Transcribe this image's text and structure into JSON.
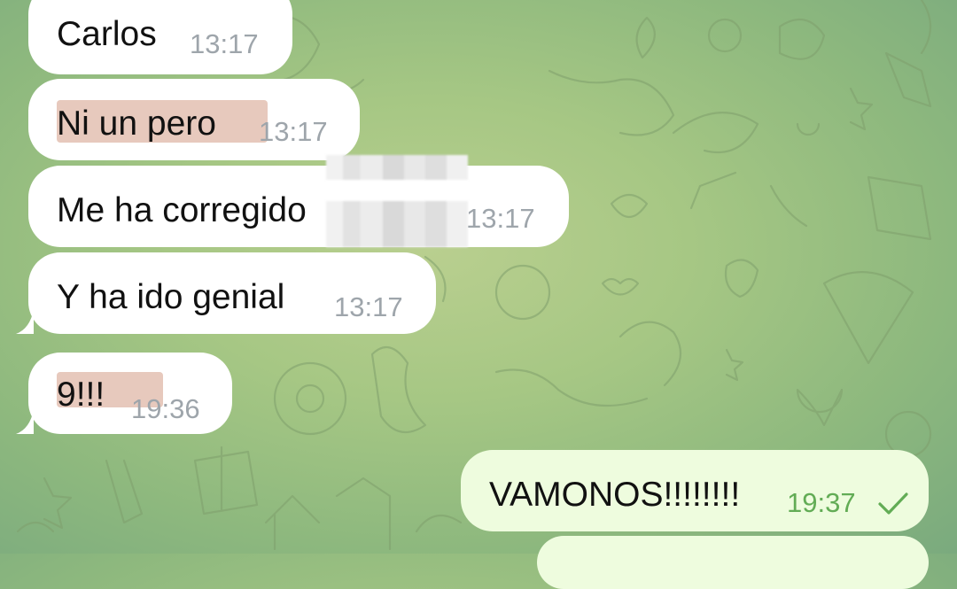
{
  "messages": [
    {
      "text": "Carlos",
      "time": "13:17"
    },
    {
      "text": "Ni un pero",
      "time": "13:17"
    },
    {
      "text": "Me ha corregido",
      "time": "13:17"
    },
    {
      "text": "Y ha ido genial",
      "time": "13:17"
    },
    {
      "text": "9!!!",
      "time": "19:36"
    },
    {
      "text": "VAMONOS!!!!!!!!",
      "time": "19:37"
    }
  ],
  "icons": {
    "read_status": "check-icon"
  },
  "colors": {
    "incoming_bubble": "#ffffff",
    "outgoing_bubble": "#eefcde",
    "highlight": "#e7c9bd",
    "time_incoming": "#9ea5ab",
    "time_outgoing": "#62ac55"
  }
}
